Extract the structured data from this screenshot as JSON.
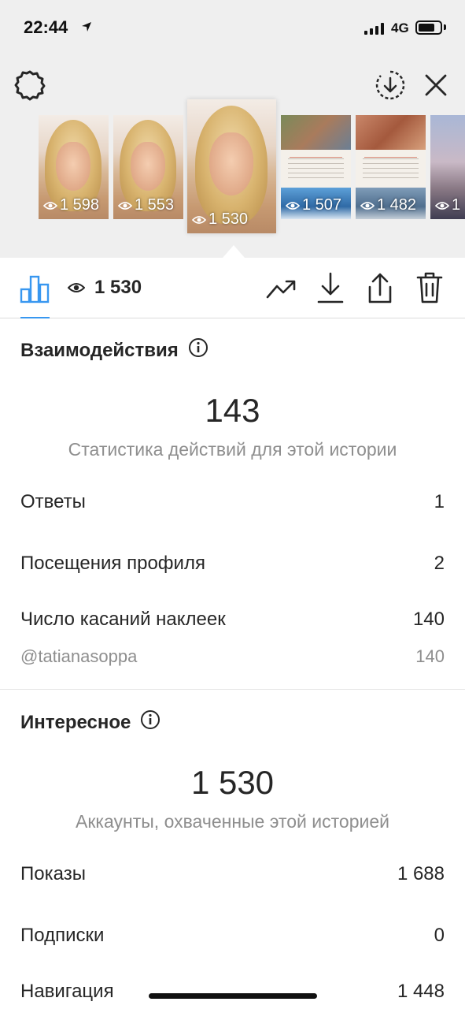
{
  "status_bar": {
    "time": "22:44",
    "network": "4G"
  },
  "thumbnails": [
    {
      "views": "1 598"
    },
    {
      "views": "1 553"
    },
    {
      "views": "1 530"
    },
    {
      "views": "1 507"
    },
    {
      "views": "1 482"
    },
    {
      "views": "1"
    }
  ],
  "toolbar": {
    "views": "1 530"
  },
  "interactions": {
    "title": "Взаимодействия",
    "total": "143",
    "subtitle": "Статистика действий для этой истории",
    "rows": [
      {
        "label": "Ответы",
        "value": "1"
      },
      {
        "label": "Посещения профиля",
        "value": "2"
      },
      {
        "label": "Число касаний наклеек",
        "value": "140"
      }
    ],
    "sticker": {
      "label": "@tatianasoppa",
      "value": "140"
    }
  },
  "discovery": {
    "title": "Интересное",
    "total": "1 530",
    "subtitle": "Аккаунты, охваченные этой историей",
    "rows": [
      {
        "label": "Показы",
        "value": "1 688"
      },
      {
        "label": "Подписки",
        "value": "0"
      },
      {
        "label": "Навигация",
        "value": "1 448"
      }
    ]
  },
  "colors": {
    "accent": "#3897f0",
    "text": "#262626",
    "muted": "#8e8e8e",
    "panel": "#efefef"
  }
}
